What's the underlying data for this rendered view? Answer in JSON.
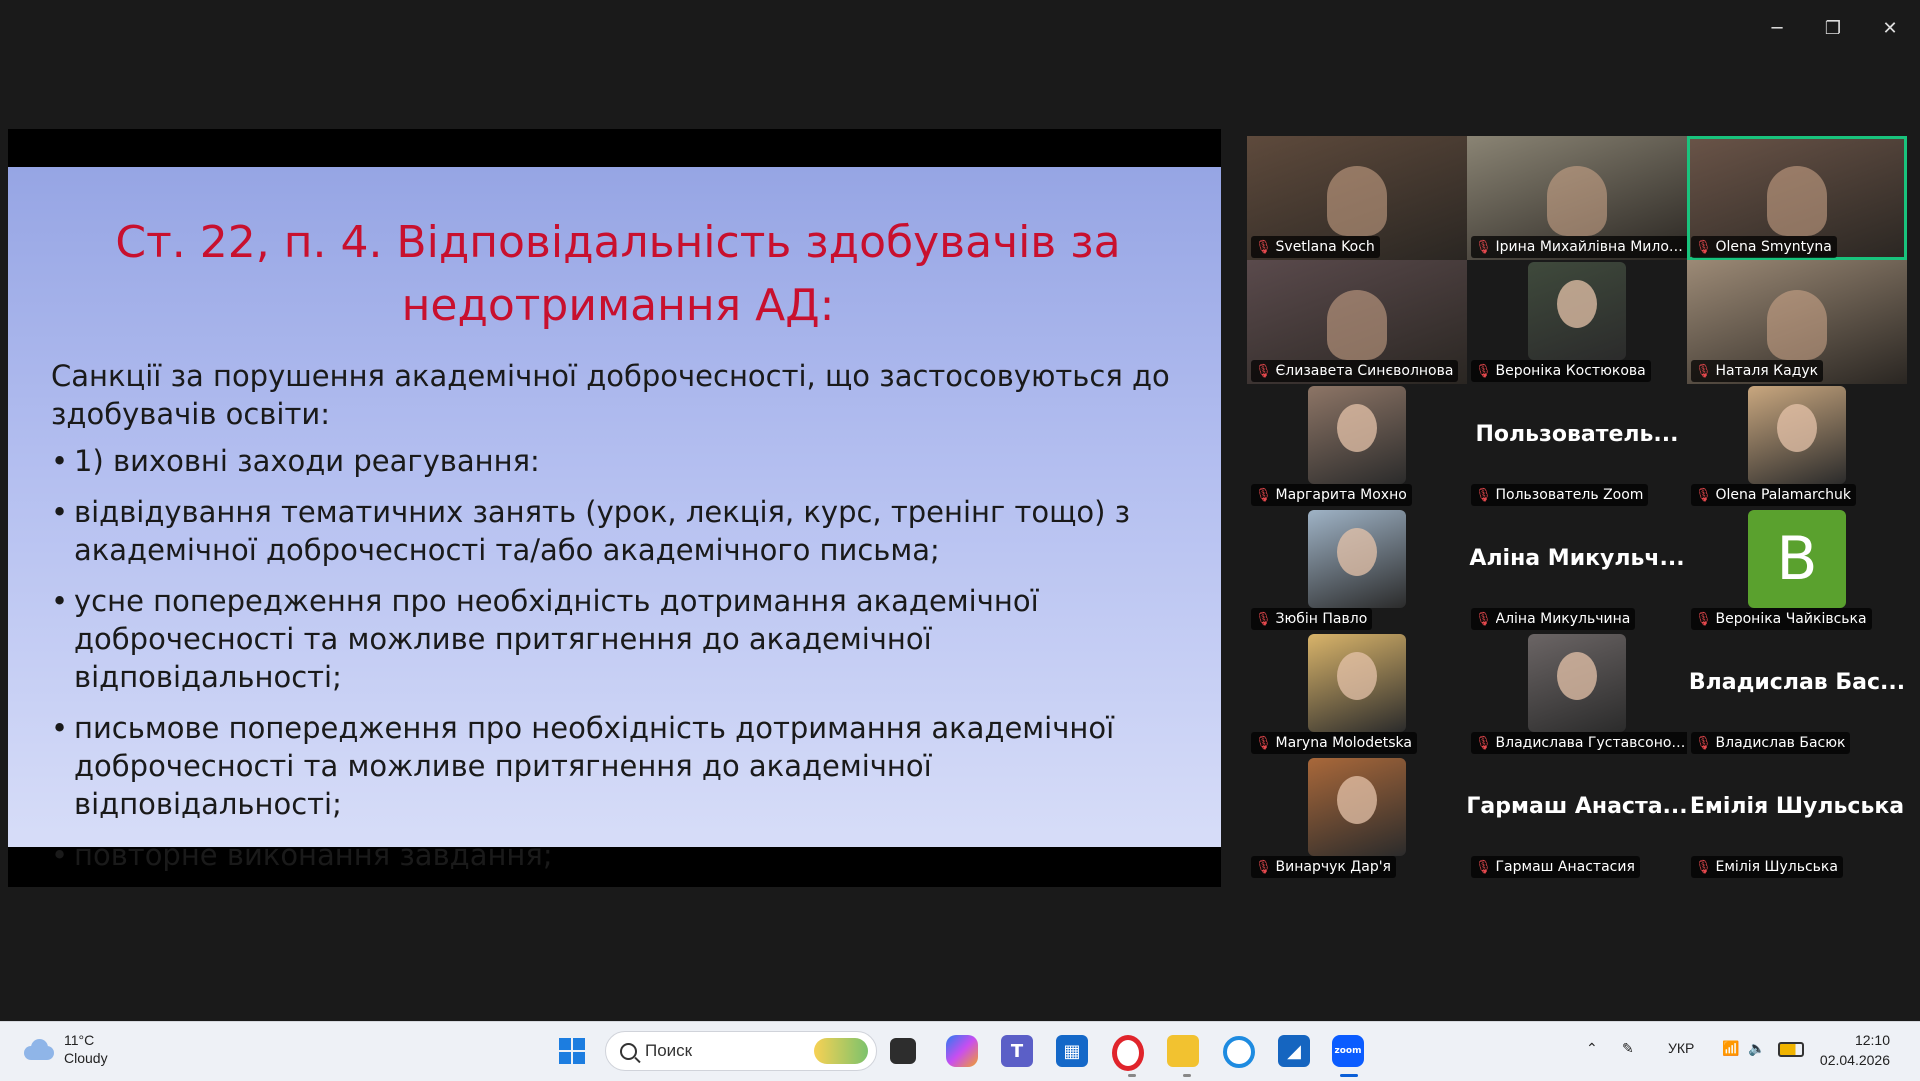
{
  "window_controls": {
    "minimize": "─",
    "restore": "❐",
    "close": "✕"
  },
  "slide": {
    "title": "Ст. 22, п. 4. Відповідальність здобувачів за недотримання АД:",
    "intro": "Санкції за порушення академічної доброчесності, що застосовуються до здобувачів освіти:",
    "bullets": [
      "1) виховні заходи реагування:",
      "відвідування тематичних занять (урок, лекція, курс, тренінг тощо) з академічної доброчесності та/або академічного письма;",
      "усне попередження про необхідність дотримання академічної доброчесності та можливе притягнення до академічної відповідальності;",
      "письмове попередження про необхідність дотримання академічної доброчесності та можливе притягнення до академічної відповідальності;",
      "повторне виконання завдання;"
    ]
  },
  "participants": [
    {
      "name": "Svetlana Koch",
      "kind": "video",
      "tone": "#5e4a3c"
    },
    {
      "name": "Ірина Михайлівна Милос...",
      "kind": "video",
      "tone": "#8a8474"
    },
    {
      "name": "Olena Smyntyna",
      "kind": "video",
      "tone": "#6a5448",
      "active": true
    },
    {
      "name": "Єлизавета Синєволнова",
      "kind": "video",
      "tone": "#5a4a4c"
    },
    {
      "name": "Вероніка Костюкова",
      "kind": "photo",
      "tone": "#3f4a3c"
    },
    {
      "name": "Наталя Кадук",
      "kind": "video",
      "tone": "#9c8a76"
    },
    {
      "name": "Маргарита Мохно",
      "kind": "photo",
      "tone": "#8d7566"
    },
    {
      "name": "Пользователь Zoom",
      "kind": "text",
      "big": "Пользователь..."
    },
    {
      "name": "Olena Palamarchuk",
      "kind": "photo",
      "tone": "#c9a77f"
    },
    {
      "name": "Зюбін Павло",
      "kind": "photo",
      "tone": "#9fb3c6"
    },
    {
      "name": "Аліна Микульчина",
      "kind": "text",
      "big": "Аліна  Микульч..."
    },
    {
      "name": "Вероніка Чайківська",
      "kind": "letter",
      "big": "B"
    },
    {
      "name": "Maryna Molodetska",
      "kind": "photo",
      "tone": "#d9b46a"
    },
    {
      "name": "Владислава Густавсонова",
      "kind": "photo",
      "tone": "#6b6565"
    },
    {
      "name": "Владислав Басюк",
      "kind": "text",
      "big": "Владислав   Бас..."
    },
    {
      "name": "Винарчук Дар'я",
      "kind": "photo",
      "tone": "#a9683a"
    },
    {
      "name": "Гармаш Анастасия",
      "kind": "text",
      "big": "Гармаш  Анаста..."
    },
    {
      "name": "Емілія Шульська",
      "kind": "text",
      "big": "Емілія Шульська"
    }
  ],
  "taskbar": {
    "weather": {
      "temp": "11°C",
      "condition": "Cloudy"
    },
    "search_placeholder": "Поиск",
    "apps": [
      "start-icon",
      "task-view-icon",
      "copilot-icon",
      "teams-icon",
      "store-icon",
      "opera-icon",
      "file-explorer-icon",
      "cortana-icon",
      "azure-icon",
      "zoom-icon"
    ],
    "zoom_label": "zoom",
    "language": "УКР",
    "time": "12:10",
    "date": "02.04.2026"
  },
  "colors": {
    "accent": "#19c37d",
    "muted_mic": "#e5484d",
    "slide_title": "#c8102e"
  }
}
